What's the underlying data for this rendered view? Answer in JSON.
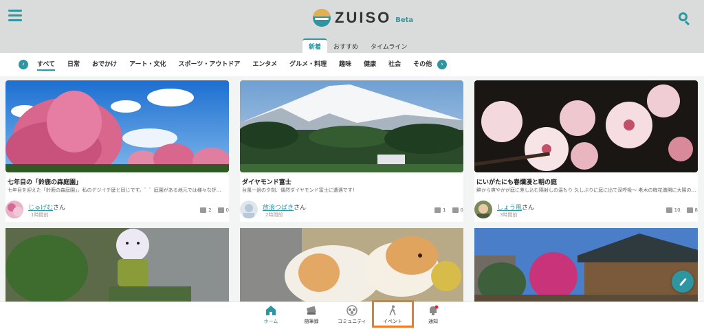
{
  "header": {
    "logo_text": "ZUISO",
    "logo_badge": "Beta",
    "menu_icon": "hamburger-icon",
    "search_icon": "search-icon",
    "accent_color": "#2e96a1"
  },
  "tabs": [
    {
      "label": "新着",
      "active": true
    },
    {
      "label": "おすすめ",
      "active": false
    },
    {
      "label": "タイムライン",
      "active": false
    }
  ],
  "categories": [
    "すべて",
    "日常",
    "おでかけ",
    "アート・文化",
    "スポーツ・アウトドア",
    "エンタメ",
    "グルメ・料理",
    "趣味",
    "健康",
    "社会",
    "その他"
  ],
  "category_nav": {
    "prev": "‹",
    "next": "›"
  },
  "posts": [
    {
      "title": "七年目の「鈴鹿の森庭園」",
      "excerpt": "七年目を迎えた「鈴鹿の森庭園」。私のデジイチ歴と同じです。゛゛庭園がある地元では様々な評…",
      "author": "じゅげむ",
      "author_suffix": "さん",
      "time": "1時間前",
      "likes": "2",
      "comments": "0"
    },
    {
      "title": "ダイヤモンド富士",
      "excerpt": "台風一過の夕刻、偶然ダイヤモンド富士に遭遇です！",
      "author": "放浪つばき",
      "author_suffix": "さん",
      "time": "2時間前",
      "likes": "1",
      "comments": "0"
    },
    {
      "title": "にいがたにも春爛漫と朝の庭",
      "excerpt": "鮮から爽やかが庭に差し込む陽射しの温もり 久しぶりに庭に出て深呼吸～ 老木の梅花満開に大陽の…",
      "author": "しょう風",
      "author_suffix": "さん",
      "time": "3時間前",
      "likes": "10",
      "comments": "8"
    }
  ],
  "bottom_nav": [
    {
      "label": "ホーム",
      "icon": "home-icon",
      "active": true
    },
    {
      "label": "随筆録",
      "icon": "book-icon",
      "active": false
    },
    {
      "label": "コミュニティ",
      "icon": "community-icon",
      "active": false
    },
    {
      "label": "イベント",
      "icon": "walking-person-icon",
      "active": false
    },
    {
      "label": "通知",
      "icon": "bell-icon",
      "active": false
    }
  ],
  "fab_icon": "pencil-icon"
}
